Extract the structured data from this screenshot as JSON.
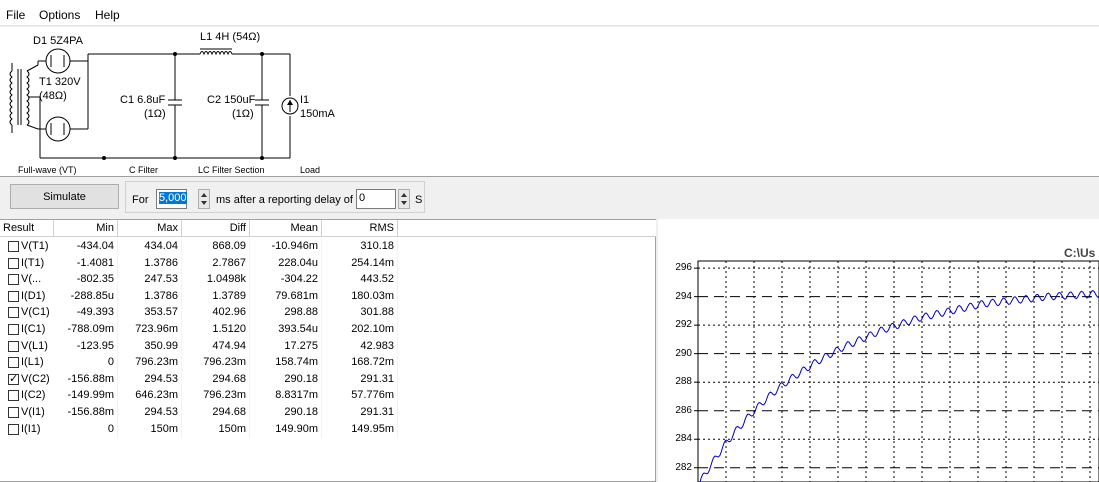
{
  "menu": {
    "file": "File",
    "options": "Options",
    "help": "Help"
  },
  "schematic": {
    "d1_label": "D1 5Z4PA",
    "l1_label": "L1 4H (54Ω)",
    "t1_name": "T1 320V",
    "t1_res": "(48Ω)",
    "c1_value": "C1 6.8uF",
    "c1_res": "(1Ω)",
    "c2_value": "C2 150uF",
    "c2_res": "(1Ω)",
    "i1_name": "I1",
    "i1_value": "150mA",
    "caption_fullwave": "Full-wave (VT)",
    "caption_cfilter": "C Filter",
    "caption_lcfilter": "LC Filter Section",
    "caption_load": "Load"
  },
  "toolbar": {
    "simulate_label": "Simulate",
    "for_label": "For",
    "duration_value": "5,000",
    "ms_label": "ms  after a reporting delay of",
    "delay_value": "0",
    "s_label": "S"
  },
  "results": {
    "columns": [
      "Result",
      "Min",
      "Max",
      "Diff",
      "Mean",
      "RMS"
    ],
    "rows": [
      {
        "name": "V(T1)",
        "checked": false,
        "min": "-434.04",
        "max": "434.04",
        "diff": "868.09",
        "mean": "-10.946m",
        "rms": "310.18"
      },
      {
        "name": "I(T1)",
        "checked": false,
        "min": "-1.4081",
        "max": "1.3786",
        "diff": "2.7867",
        "mean": "228.04u",
        "rms": "254.14m"
      },
      {
        "name": "V(...",
        "checked": false,
        "min": "-802.35",
        "max": "247.53",
        "diff": "1.0498k",
        "mean": "-304.22",
        "rms": "443.52"
      },
      {
        "name": "I(D1)",
        "checked": false,
        "min": "-288.85u",
        "max": "1.3786",
        "diff": "1.3789",
        "mean": "79.681m",
        "rms": "180.03m"
      },
      {
        "name": "V(C1)",
        "checked": false,
        "min": "-49.393",
        "max": "353.57",
        "diff": "402.96",
        "mean": "298.88",
        "rms": "301.88"
      },
      {
        "name": "I(C1)",
        "checked": false,
        "min": "-788.09m",
        "max": "723.96m",
        "diff": "1.5120",
        "mean": "393.54u",
        "rms": "202.10m"
      },
      {
        "name": "V(L1)",
        "checked": false,
        "min": "-123.95",
        "max": "350.99",
        "diff": "474.94",
        "mean": "17.275",
        "rms": "42.983"
      },
      {
        "name": "I(L1)",
        "checked": false,
        "min": "0",
        "max": "796.23m",
        "diff": "796.23m",
        "mean": "158.74m",
        "rms": "168.72m"
      },
      {
        "name": "V(C2)",
        "checked": true,
        "min": "-156.88m",
        "max": "294.53",
        "diff": "294.68",
        "mean": "290.18",
        "rms": "291.31"
      },
      {
        "name": "I(C2)",
        "checked": false,
        "min": "-149.99m",
        "max": "646.23m",
        "diff": "796.23m",
        "mean": "8.8317m",
        "rms": "57.776m"
      },
      {
        "name": "V(I1)",
        "checked": false,
        "min": "-156.88m",
        "max": "294.53",
        "diff": "294.68",
        "mean": "290.18",
        "rms": "291.31"
      },
      {
        "name": "I(I1)",
        "checked": false,
        "min": "0",
        "max": "150m",
        "diff": "150m",
        "mean": "149.90m",
        "rms": "149.95m"
      }
    ]
  },
  "chart": {
    "title_visible": "C:\\Us",
    "line_color": "#0000c0"
  },
  "chart_data": {
    "type": "line",
    "title": "",
    "xlabel": "",
    "ylabel": "",
    "ylim": [
      281,
      296.5
    ],
    "yticks": [
      "296",
      "294",
      "292",
      "290",
      "288",
      "286",
      "284",
      "282"
    ],
    "series": [
      {
        "values": [
          281.0,
          282.4,
          283.7,
          284.8,
          285.8,
          286.7,
          287.5,
          288.2,
          288.8,
          289.4,
          289.9,
          290.4,
          290.8,
          291.2,
          291.6,
          291.9,
          292.2,
          292.5,
          292.7,
          292.9,
          293.1,
          293.3,
          293.5,
          293.6,
          293.7,
          293.8,
          293.9,
          294.0,
          294.05,
          294.1,
          294.15,
          294.2
        ]
      }
    ],
    "grid": true
  }
}
